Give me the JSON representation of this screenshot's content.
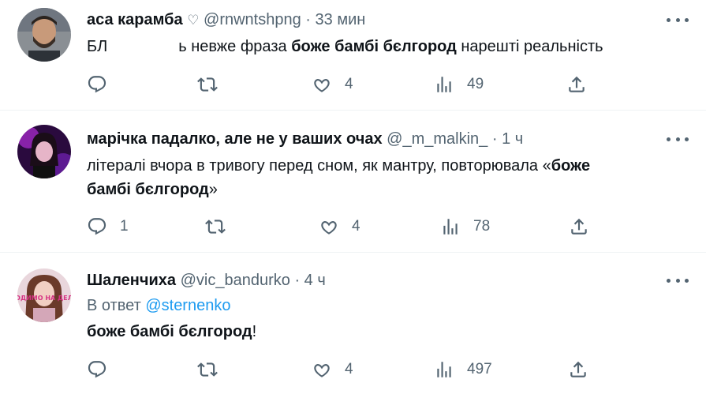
{
  "tweets": [
    {
      "name": "аса карамба",
      "name_mark": "♡",
      "handle": "@rnwntshpng",
      "separator": "·",
      "time": "33 мин",
      "text_a": "БЛ",
      "text_b": "ь невже фраза ",
      "text_bold": "боже бамбі бєлгород",
      "text_c": " нарешті реальність",
      "replies": "",
      "retweets": "",
      "likes": "4",
      "views": "49"
    },
    {
      "name": "марічка падалко, але не у ваших очах",
      "handle": "@_m_malkin_",
      "separator": "·",
      "time": "1 ч",
      "line1": "літералі вчора в тривогу перед сном, як мантру, повторювала «",
      "line1_bold": "боже",
      "line2_bold": "бамбі бєлгород",
      "line2_end": "»",
      "replies": "1",
      "retweets": "",
      "likes": "4",
      "views": "78"
    },
    {
      "name": "Шаленчиха",
      "handle": "@vic_bandurko",
      "separator": "·",
      "time": "4 ч",
      "reply_prefix": "В ответ ",
      "reply_to": "@sternenko",
      "text_bold": "боже бамбі бєлгород",
      "text_end": "!",
      "avatar_text": "ХОДИМО НА ДЕЛО",
      "replies": "",
      "retweets": "",
      "likes": "4",
      "views": "497"
    }
  ],
  "icons": [
    "more-icon",
    "reply-icon",
    "retweet-icon",
    "like-icon",
    "views-icon",
    "share-icon"
  ],
  "colors": {
    "text": "#0f1419",
    "secondary": "#536471",
    "link": "#1d9bf0",
    "divider": "#eff3f4"
  }
}
